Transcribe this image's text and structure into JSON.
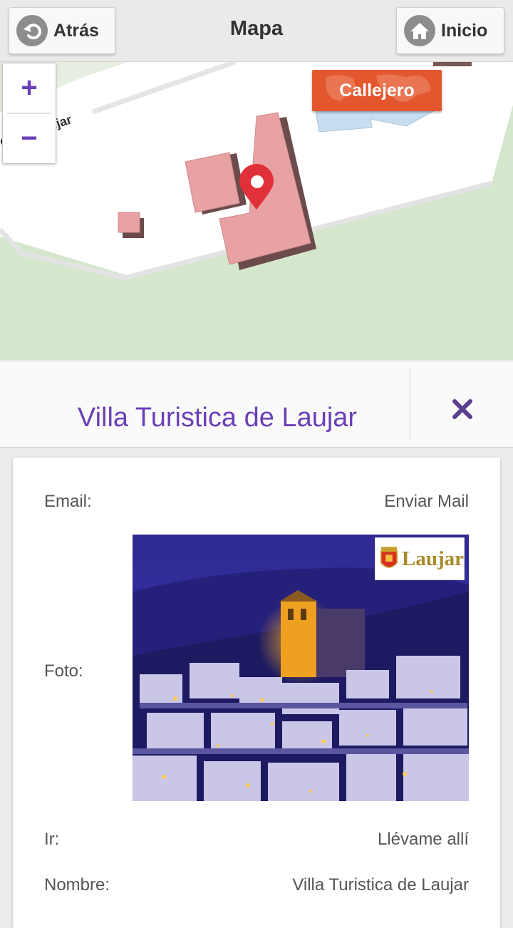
{
  "header": {
    "back_label": "Atrás",
    "title": "Mapa",
    "home_label": "Inicio",
    "back_icon": "back-arrow-icon",
    "home_icon": "home-icon"
  },
  "map": {
    "street_label": "ca de Laujar",
    "callejero_label": "Callejero",
    "zoom_in": "+",
    "zoom_out": "−",
    "marker_icon": "map-pin-icon"
  },
  "place": {
    "title": "Villa Turistica de Laujar"
  },
  "details": {
    "email_label": "Email:",
    "email_value": "Enviar Mail",
    "photo_label": "Foto:",
    "photo_logo_text": "Laujar",
    "go_label": "Ir:",
    "go_value": "Llévame allí",
    "name_label": "Nombre:",
    "name_value": "Villa Turistica de Laujar"
  },
  "colors": {
    "accent": "#6a3fb8",
    "callejero": "#e4572e",
    "marker": "#e0313a"
  }
}
